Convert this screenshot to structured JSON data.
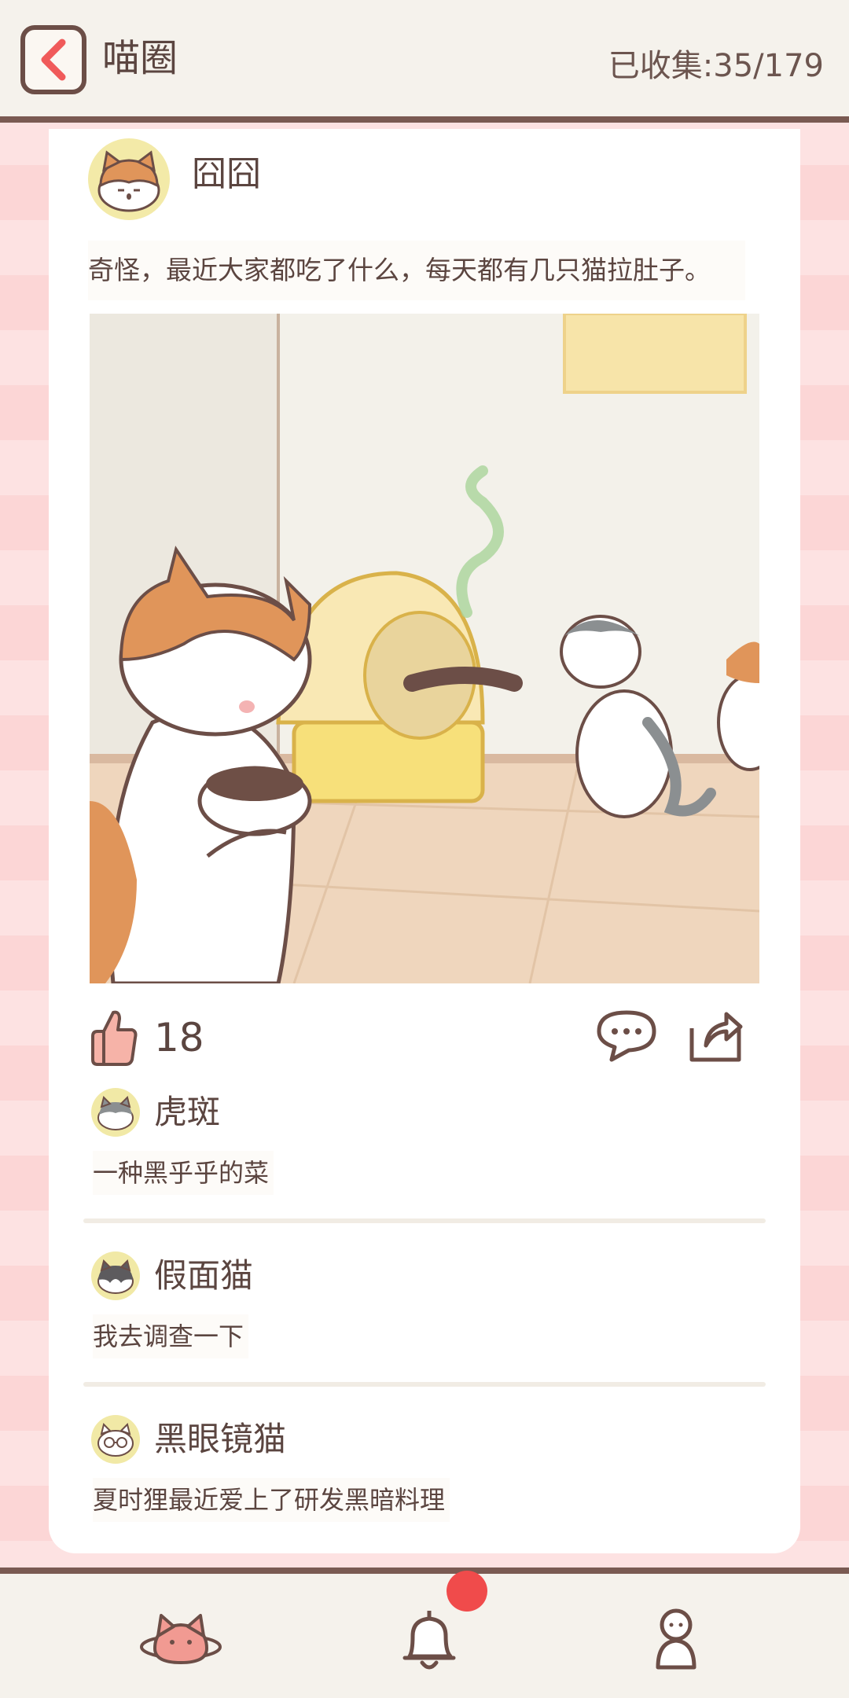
{
  "header": {
    "title": "喵圈",
    "collected_label": "已收集:",
    "collected_value": "35/179"
  },
  "post": {
    "author": "囧囧",
    "text": "奇怪，最近大家都吃了什么，每天都有几只猫拉肚子。",
    "likes": "18",
    "image_icon": "cats-litterbox-illustration"
  },
  "comments": [
    {
      "name": "虎斑",
      "text": "一种黑乎乎的菜",
      "avatar": "tabby-cat-icon"
    },
    {
      "name": "假面猫",
      "text": "我去调查一下",
      "avatar": "masked-cat-icon"
    },
    {
      "name": "黑眼镜猫",
      "text": "夏时狸最近爱上了研发黑暗料理",
      "avatar": "glasses-cat-icon"
    }
  ],
  "nav": {
    "items": [
      "planet-cat-icon",
      "bell-icon",
      "person-icon"
    ],
    "has_notification": true
  },
  "colors": {
    "accent": "#f04b4b",
    "border": "#7a5a52",
    "text": "#5b4540",
    "background_pink": "#fde2e2"
  }
}
